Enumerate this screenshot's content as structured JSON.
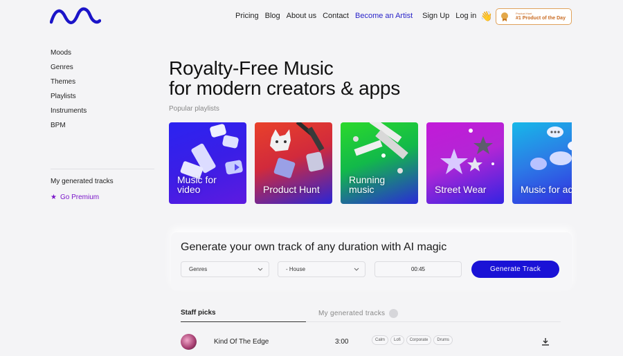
{
  "header": {
    "logo_icon": "wave-logo-icon",
    "nav": [
      {
        "label": "Pricing"
      },
      {
        "label": "Blog"
      },
      {
        "label": "About us"
      },
      {
        "label": "Contact"
      },
      {
        "label": "Become an Artist"
      },
      {
        "label": "Sign Up"
      },
      {
        "label": "Log in"
      }
    ],
    "badge": {
      "sub": "Product Hunt",
      "main": "#1 Product of the Day"
    },
    "accent": "#2a24c9"
  },
  "sidebar": {
    "items": [
      {
        "label": "Moods"
      },
      {
        "label": "Genres"
      },
      {
        "label": "Themes"
      },
      {
        "label": "Playlists"
      },
      {
        "label": "Instruments"
      },
      {
        "label": "BPM"
      }
    ],
    "generated": "My generated tracks",
    "premium": "Go Premium",
    "premium_color": "#7a16c9"
  },
  "hero": {
    "title_line1": "Royalty-Free Music",
    "title_line2": "for modern creators & apps",
    "popular": "Popular playlists"
  },
  "playlists": [
    {
      "label": "Music for\nvideo"
    },
    {
      "label": "Product Hunt"
    },
    {
      "label": "Running\nmusic"
    },
    {
      "label": "Street Wear"
    },
    {
      "label": "Music for ads"
    }
  ],
  "generator": {
    "title": "Generate your own track of any duration with AI magic",
    "genre_select": "Genres",
    "style_select": "- House",
    "duration": "00:45",
    "button": "Generate Track",
    "button_color": "#1a12d6"
  },
  "tabs": {
    "staff": "Staff picks",
    "generated": "My generated tracks"
  },
  "tracks": [
    {
      "name": "Kind Of The Edge",
      "duration": "3:00",
      "tags": [
        "Calm",
        "Lofi",
        "Corporate",
        "Drums"
      ]
    }
  ]
}
